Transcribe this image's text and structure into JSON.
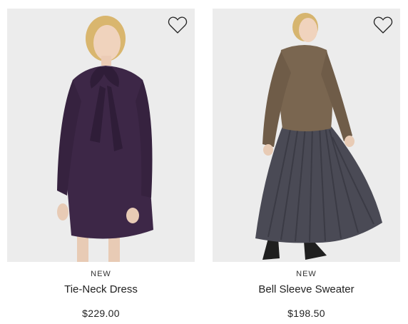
{
  "products": [
    {
      "badge": "NEW",
      "name": "Tie-Neck Dress",
      "price": "$229.00",
      "wishlist_icon": "heart-outline-icon",
      "garment_color": "#3d2747"
    },
    {
      "badge": "NEW",
      "name": "Bell Sleeve Sweater",
      "price": "$198.50",
      "wishlist_icon": "heart-outline-icon",
      "sweater_color": "#7a6650",
      "skirt_color": "#4a4a55"
    }
  ],
  "colors": {
    "photo_background": "#ececec",
    "text": "#222222"
  }
}
